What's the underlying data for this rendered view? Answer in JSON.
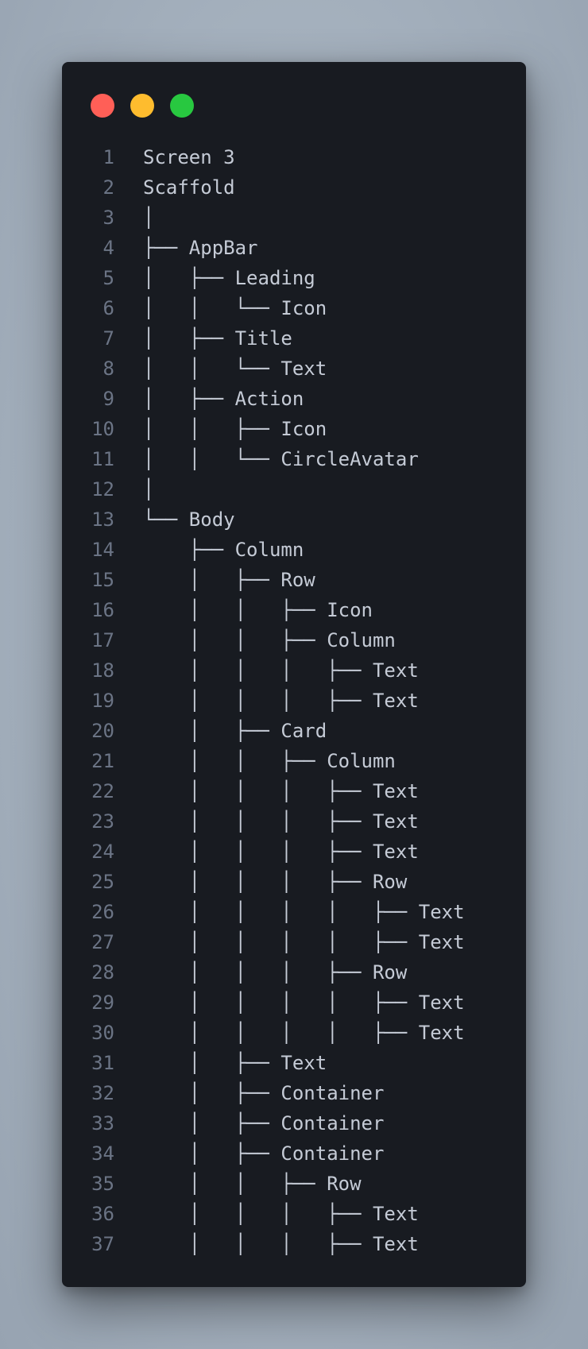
{
  "window": {
    "controls": [
      {
        "name": "close",
        "color": "#ff5f57"
      },
      {
        "name": "minimize",
        "color": "#febc2e"
      },
      {
        "name": "maximize",
        "color": "#28c840"
      }
    ]
  },
  "code": {
    "lines": [
      {
        "number": "1",
        "text": "Screen 3"
      },
      {
        "number": "2",
        "text": "Scaffold"
      },
      {
        "number": "3",
        "text": "│"
      },
      {
        "number": "4",
        "text": "├── AppBar"
      },
      {
        "number": "5",
        "text": "│   ├── Leading"
      },
      {
        "number": "6",
        "text": "│   │   └── Icon"
      },
      {
        "number": "7",
        "text": "│   ├── Title"
      },
      {
        "number": "8",
        "text": "│   │   └── Text"
      },
      {
        "number": "9",
        "text": "│   ├── Action"
      },
      {
        "number": "10",
        "text": "│   │   ├── Icon"
      },
      {
        "number": "11",
        "text": "│   │   └── CircleAvatar"
      },
      {
        "number": "12",
        "text": "│"
      },
      {
        "number": "13",
        "text": "└── Body"
      },
      {
        "number": "14",
        "text": "    ├── Column"
      },
      {
        "number": "15",
        "text": "    │   ├── Row"
      },
      {
        "number": "16",
        "text": "    │   │   ├── Icon"
      },
      {
        "number": "17",
        "text": "    │   │   ├── Column"
      },
      {
        "number": "18",
        "text": "    │   │   │   ├── Text"
      },
      {
        "number": "19",
        "text": "    │   │   │   ├── Text"
      },
      {
        "number": "20",
        "text": "    │   ├── Card"
      },
      {
        "number": "21",
        "text": "    │   │   ├── Column"
      },
      {
        "number": "22",
        "text": "    │   │   │   ├── Text"
      },
      {
        "number": "23",
        "text": "    │   │   │   ├── Text"
      },
      {
        "number": "24",
        "text": "    │   │   │   ├── Text"
      },
      {
        "number": "25",
        "text": "    │   │   │   ├── Row"
      },
      {
        "number": "26",
        "text": "    │   │   │   │   ├── Text"
      },
      {
        "number": "27",
        "text": "    │   │   │   │   ├── Text"
      },
      {
        "number": "28",
        "text": "    │   │   │   ├── Row"
      },
      {
        "number": "29",
        "text": "    │   │   │   │   ├── Text"
      },
      {
        "number": "30",
        "text": "    │   │   │   │   ├── Text"
      },
      {
        "number": "31",
        "text": "    │   ├── Text"
      },
      {
        "number": "32",
        "text": "    │   ├── Container"
      },
      {
        "number": "33",
        "text": "    │   ├── Container"
      },
      {
        "number": "34",
        "text": "    │   ├── Container"
      },
      {
        "number": "35",
        "text": "    │   │   ├── Row"
      },
      {
        "number": "36",
        "text": "    │   │   │   ├── Text"
      },
      {
        "number": "37",
        "text": "    │   │   │   ├── Text"
      }
    ]
  }
}
